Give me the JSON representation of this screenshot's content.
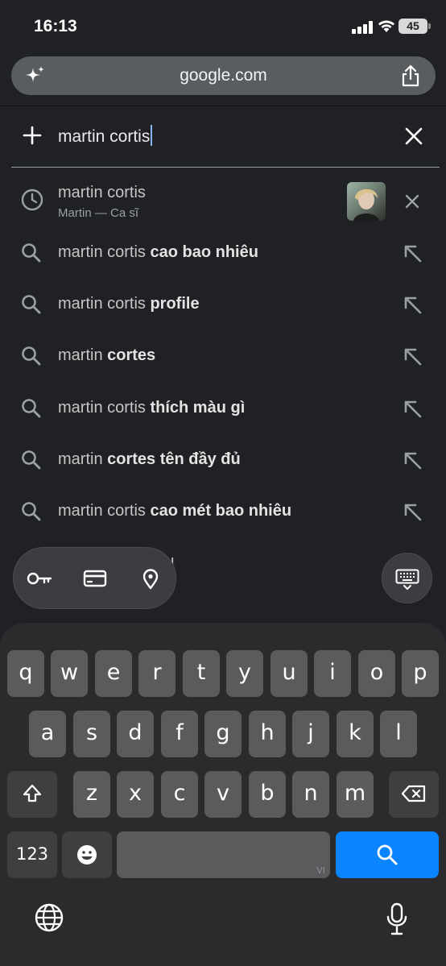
{
  "status_bar": {
    "time": "16:13",
    "battery": "45"
  },
  "url_bar": {
    "url": "google.com"
  },
  "search": {
    "query": "martin cortis"
  },
  "history": {
    "title": "martin cortis",
    "subtitle": "Martin — Ca sĩ"
  },
  "suggestions": [
    {
      "prefix": "martin cortis ",
      "bold": "cao bao nhiêu"
    },
    {
      "prefix": "martin cortis ",
      "bold": "profile"
    },
    {
      "prefix": "martin ",
      "bold": "cortes"
    },
    {
      "prefix": "martin cortis ",
      "bold": "thích màu gì"
    },
    {
      "prefix": "martin ",
      "bold": "cortes tên đầy đủ"
    },
    {
      "prefix": "martin cortis ",
      "bold": "cao mét bao nhiêu"
    }
  ],
  "autofill": {
    "peek_text": "l"
  },
  "keyboard": {
    "row1": [
      "q",
      "w",
      "e",
      "r",
      "t",
      "y",
      "u",
      "i",
      "o",
      "p"
    ],
    "row2": [
      "a",
      "s",
      "d",
      "f",
      "g",
      "h",
      "j",
      "k",
      "l"
    ],
    "row3": [
      "z",
      "x",
      "c",
      "v",
      "b",
      "n",
      "m"
    ],
    "numbers_key": "123",
    "space_lang": "VI"
  },
  "colors": {
    "accent": "#0a84ff",
    "caret": "#8ab4f8",
    "background": "#202124"
  }
}
